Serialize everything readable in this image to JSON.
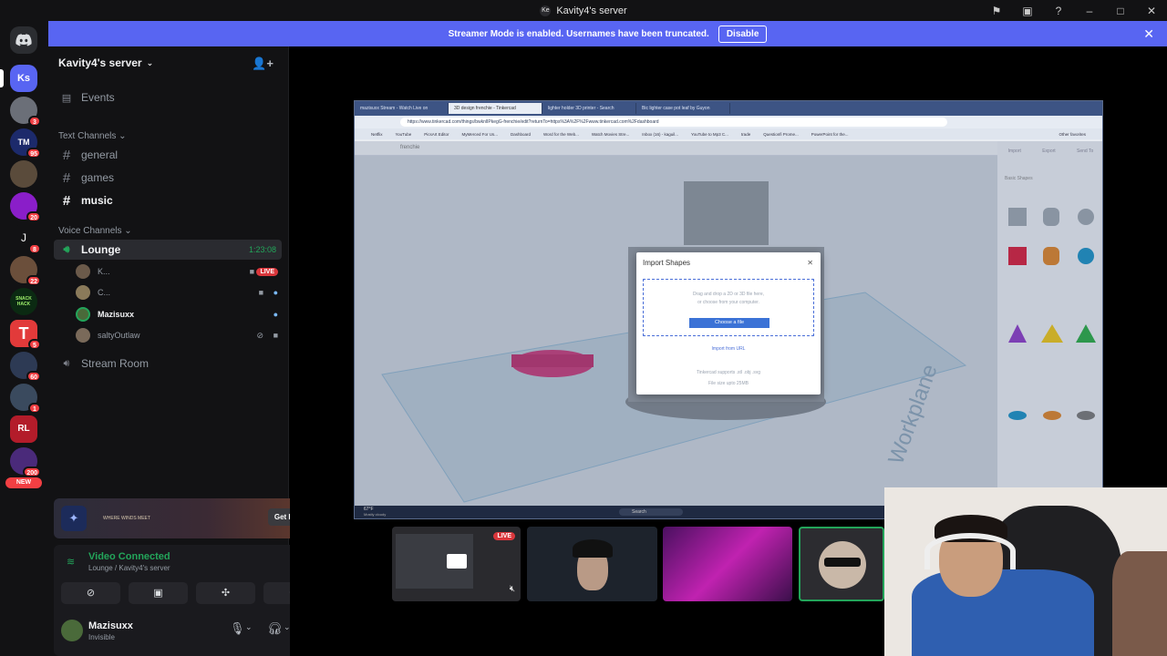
{
  "window": {
    "title": "Kavity4's server",
    "title_avatar": "Ke"
  },
  "banner": {
    "text": "Streamer Mode is enabled. Usernames have been truncated.",
    "button": "Disable"
  },
  "rail": {
    "guilds": [
      {
        "label": "",
        "badge": ""
      },
      {
        "label": "Ks",
        "badge": ""
      },
      {
        "label": "",
        "badge": "3"
      },
      {
        "label": "TM",
        "badge": "95"
      },
      {
        "label": "",
        "badge": ""
      },
      {
        "label": "",
        "badge": "20"
      },
      {
        "label": "J",
        "badge": "8"
      },
      {
        "label": "",
        "badge": "22"
      },
      {
        "label": "SNACK HACK",
        "badge": ""
      },
      {
        "label": "T",
        "badge": "5"
      },
      {
        "label": "",
        "badge": "60"
      },
      {
        "label": "",
        "badge": "1"
      },
      {
        "label": "RL",
        "badge": ""
      },
      {
        "label": "",
        "badge": "200"
      }
    ],
    "new_label": "NEW"
  },
  "sidebar": {
    "server_name": "Kavity4's server",
    "events": "Events",
    "text_category": "Text Channels",
    "text_channels": [
      "general",
      "games",
      "music"
    ],
    "voice_category": "Voice Channels",
    "voice_channels": {
      "lounge": "Lounge",
      "lounge_time": "1:23:08",
      "stream_room": "Stream Room"
    },
    "voice_users": [
      {
        "name": "K...",
        "live": "LIVE"
      },
      {
        "name": "C..."
      },
      {
        "name": "Mazisuxx"
      },
      {
        "name": "saltyOutlaw"
      }
    ]
  },
  "promo": {
    "logo_text": "WHERE WINDS MEET",
    "button": "Get Reward!"
  },
  "voice_panel": {
    "status": "Video Connected",
    "location": "Lounge / Kavity4's server"
  },
  "user_panel": {
    "name": "Mazisuxx",
    "status": "Invisible"
  },
  "stream": {
    "browser_tabs": [
      "mazisuxx Stream - Watch Live on",
      "3D design frenchie - Tinkercad",
      "lighter holder 3D printer - Search",
      "Bic lighter case pot leaf by Guyon"
    ],
    "url": "https://www.tinkercad.com/things/bwknlIPkegG-frenchie/edit?returnTo=https%3A%2F%2Fwww.tinkercad.com%2Fdashboard",
    "bookmarks": [
      "Netflix",
      "YouTube",
      "PicsArt Editor",
      "MyMerced For Us...",
      "Dashboard",
      "Word for the Web...",
      "Watch Movies Stre...",
      "Inbox (16) - kaguil...",
      "YouTube to Mp3 C...",
      "trade",
      "Questionfi Prome...",
      "PowerPoint for the..."
    ],
    "other_favorites": "Other favorites",
    "design_name": "frenchie",
    "right_tools": [
      "Import",
      "Export",
      "Send To"
    ],
    "shapes_label": "Basic Shapes",
    "workplane_text": "Workplane",
    "weather": "67°F",
    "weather_sub": "Mostly cloudy",
    "taskbar_search": "Search",
    "dialog": {
      "title": "Import Shapes",
      "drop_text_1": "Drag and drop a 2D or 3D file here,",
      "drop_text_2": "or choose from your computer.",
      "choose_button": "Choose a file",
      "import_url": "Import from URL",
      "supports": "Tinkercad supports .stl .obj .svg",
      "file_size": "File size upto 25MB"
    }
  },
  "tiles": {
    "live": "LIVE"
  }
}
